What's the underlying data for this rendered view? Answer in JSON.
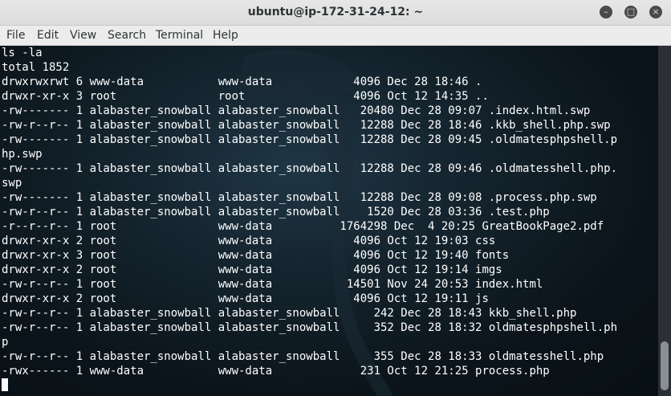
{
  "window": {
    "title": "ubuntu@ip-172-31-24-12: ~"
  },
  "menu": [
    "File",
    "Edit",
    "View",
    "Search",
    "Terminal",
    "Help"
  ],
  "terminal": {
    "lines": [
      "ls -la",
      "total 1852",
      "drwxrwxrwt 6 www-data           www-data            4096 Dec 28 18:46 .",
      "drwxr-xr-x 3 root               root                4096 Oct 12 14:35 ..",
      "-rw------- 1 alabaster_snowball alabaster_snowball   20480 Dec 28 09:07 .index.html.swp",
      "-rw-r--r-- 1 alabaster_snowball alabaster_snowball   12288 Dec 28 18:46 .kkb_shell.php.swp",
      "-rw------- 1 alabaster_snowball alabaster_snowball   12288 Dec 28 09:45 .oldmatesphpshell.p",
      "hp.swp",
      "-rw------- 1 alabaster_snowball alabaster_snowball   12288 Dec 28 09:46 .oldmatesshell.php.",
      "swp",
      "-rw------- 1 alabaster_snowball alabaster_snowball   12288 Dec 28 09:08 .process.php.swp",
      "-rw-r--r-- 1 alabaster_snowball alabaster_snowball    1520 Dec 28 03:36 .test.php",
      "-r--r--r-- 1 root               www-data          1764298 Dec  4 20:25 GreatBookPage2.pdf",
      "drwxr-xr-x 2 root               www-data            4096 Oct 12 19:03 css",
      "drwxr-xr-x 3 root               www-data            4096 Oct 12 19:40 fonts",
      "drwxr-xr-x 2 root               www-data            4096 Oct 12 19:14 imgs",
      "-rw-r--r-- 1 root               www-data           14501 Nov 24 20:53 index.html",
      "drwxr-xr-x 2 root               www-data            4096 Oct 12 19:11 js",
      "-rw-r--r-- 1 alabaster_snowball alabaster_snowball     242 Dec 28 18:43 kkb_shell.php",
      "-rw-r--r-- 1 alabaster_snowball alabaster_snowball     352 Dec 28 18:32 oldmatesphpshell.ph",
      "p",
      "-rw-r--r-- 1 alabaster_snowball alabaster_snowball     355 Dec 28 18:33 oldmatesshell.php",
      "-rwx------ 1 www-data           www-data             231 Oct 12 21:25 process.php"
    ]
  },
  "scrollbar": {
    "position": 0.98,
    "visible_fraction": 0.14
  },
  "colors": {
    "terminal_bg": "#0b1218",
    "text": "#ffffff",
    "titlebar": "#e2e2e2"
  }
}
